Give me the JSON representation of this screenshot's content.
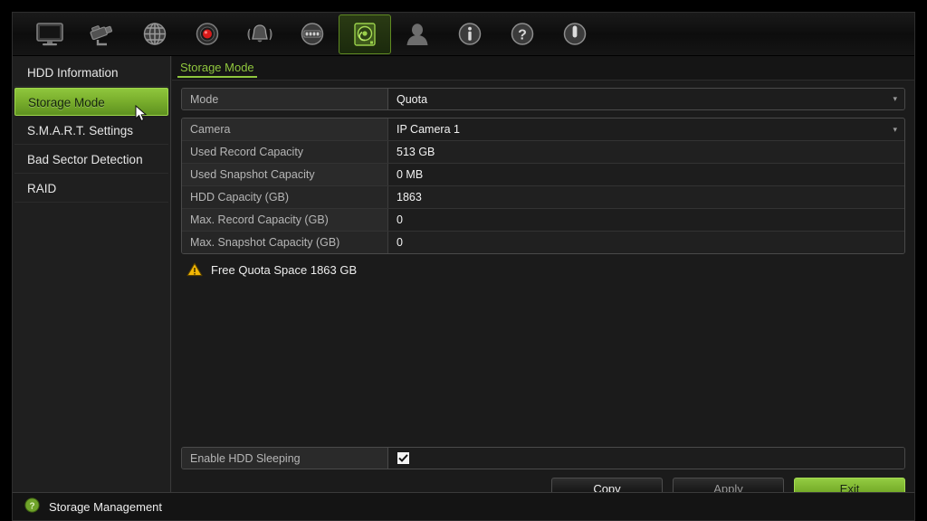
{
  "toolbar": {
    "items": [
      {
        "icon": "monitor-icon",
        "name": "live-view",
        "active": false
      },
      {
        "icon": "camera-icon",
        "name": "camera",
        "active": false
      },
      {
        "icon": "network-globe-icon",
        "name": "network",
        "active": false
      },
      {
        "icon": "record-icon",
        "name": "record",
        "active": false
      },
      {
        "icon": "alarm-bell-icon",
        "name": "alarm",
        "active": false
      },
      {
        "icon": "device-icon",
        "name": "device",
        "active": false
      },
      {
        "icon": "hdd-icon",
        "name": "storage",
        "active": true
      },
      {
        "icon": "user-icon",
        "name": "user",
        "active": false
      },
      {
        "icon": "info-icon",
        "name": "info",
        "active": false
      },
      {
        "icon": "help-icon",
        "name": "help",
        "active": false
      },
      {
        "icon": "power-icon",
        "name": "shutdown",
        "active": false
      }
    ]
  },
  "sidebar": {
    "items": [
      {
        "label": "HDD Information",
        "selected": false
      },
      {
        "label": "Storage Mode",
        "selected": true
      },
      {
        "label": "S.M.A.R.T. Settings",
        "selected": false
      },
      {
        "label": "Bad Sector Detection",
        "selected": false
      },
      {
        "label": "RAID",
        "selected": false
      }
    ]
  },
  "main": {
    "tab_label": "Storage Mode",
    "mode_row": {
      "label": "Mode",
      "value": "Quota",
      "chevron": "▾"
    },
    "table": {
      "rows": [
        {
          "label": "Camera",
          "value": "IP Camera 1",
          "dropdown": true,
          "chevron": "▾"
        },
        {
          "label": "Used Record Capacity",
          "value": "513 GB",
          "dropdown": false
        },
        {
          "label": "Used Snapshot Capacity",
          "value": "0 MB",
          "dropdown": false
        },
        {
          "label": "HDD Capacity (GB)",
          "value": "1863",
          "dropdown": false
        },
        {
          "label": "Max. Record Capacity (GB)",
          "value": "0",
          "dropdown": false
        },
        {
          "label": "Max. Snapshot Capacity (GB)",
          "value": "0",
          "dropdown": false
        }
      ]
    },
    "warning": {
      "icon": "warning-triangle-icon",
      "text": "Free Quota Space 1863 GB"
    },
    "sleep_row": {
      "label": "Enable HDD Sleeping",
      "checked": true
    },
    "buttons": [
      {
        "label": "Copy",
        "style": "normal"
      },
      {
        "label": "Apply",
        "style": "dim"
      },
      {
        "label": "Exit",
        "style": "green"
      }
    ]
  },
  "statusbar": {
    "icon": "help-circle-icon",
    "text": "Storage Management"
  },
  "colors": {
    "accent_green": "#8fc63d",
    "warning_yellow": "#f2b705",
    "panel_bg": "#1b1b1b",
    "label_text": "#b6b6b6",
    "value_text": "#f2f2f2"
  }
}
